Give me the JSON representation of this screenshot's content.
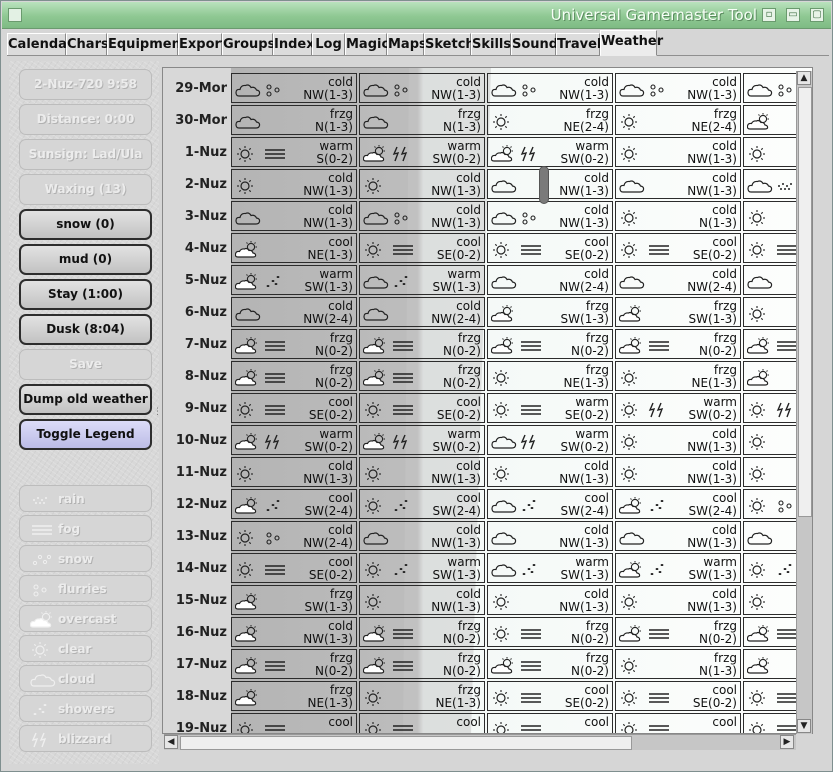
{
  "app": {
    "title": "Universal Gamemaster Tool",
    "controls": {
      "minimize": "▫",
      "maximize": "▭",
      "close": "▢"
    }
  },
  "tabs": [
    "Calendar",
    "Chars",
    "Equipment",
    "Export",
    "Groups",
    "Index",
    "Log",
    "Magic",
    "Maps",
    "Sketch",
    "Skills",
    "Sound",
    "Travel",
    "Weather"
  ],
  "active_tab": "Weather",
  "left_buttons": [
    {
      "label": "2-Nuz-720 9:58",
      "enabled": false
    },
    {
      "label": "Distance: 0:00",
      "enabled": false
    },
    {
      "label": "Sunsign: Lad/Ula",
      "enabled": false
    },
    {
      "label": "Waxing (13)",
      "enabled": false
    },
    {
      "label": "snow (0)",
      "enabled": true
    },
    {
      "label": "mud (0)",
      "enabled": true
    },
    {
      "label": "Stay (1:00)",
      "enabled": true
    },
    {
      "label": "Dusk (8:04)",
      "enabled": true
    },
    {
      "label": "Save",
      "enabled": false
    },
    {
      "label": "Dump old weather",
      "enabled": true
    },
    {
      "label": "Toggle Legend",
      "enabled": true,
      "style": "legend"
    }
  ],
  "legend": [
    {
      "label": "rain",
      "icon": "rain"
    },
    {
      "label": "fog",
      "icon": "fog"
    },
    {
      "label": "snow",
      "icon": "snow"
    },
    {
      "label": "flurries",
      "icon": "flurries"
    },
    {
      "label": "overcast",
      "icon": "overcast"
    },
    {
      "label": "clear",
      "icon": "clear"
    },
    {
      "label": "cloud",
      "icon": "cloud"
    },
    {
      "label": "showers",
      "icon": "showers"
    },
    {
      "label": "blizzard",
      "icon": "blizzard"
    }
  ],
  "weather": {
    "rows": [
      {
        "date": "29-Mor",
        "cells": [
          {
            "temp": "cold",
            "wind": "NW(1-3)",
            "icons": [
              "cloud",
              "flurries"
            ]
          },
          {
            "temp": "cold",
            "wind": "NW(1-3)",
            "icons": [
              "cloud",
              "flurries"
            ]
          },
          {
            "temp": "cold",
            "wind": "NW(1-3)",
            "icons": [
              "cloud",
              "flurries"
            ]
          },
          {
            "temp": "cold",
            "wind": "NW(1-3)",
            "icons": [
              "cloud",
              "flurries"
            ]
          },
          {
            "temp": "",
            "wind": "",
            "icons": [
              "cloud",
              "flurries"
            ]
          }
        ]
      },
      {
        "date": "30-Mor",
        "cells": [
          {
            "temp": "frzg",
            "wind": "N(1-3)",
            "icons": [
              "cloud"
            ]
          },
          {
            "temp": "frzg",
            "wind": "N(1-3)",
            "icons": [
              "cloud"
            ]
          },
          {
            "temp": "frzg",
            "wind": "NE(2-4)",
            "icons": [
              "clear"
            ]
          },
          {
            "temp": "frzg",
            "wind": "NE(2-4)",
            "icons": [
              "clear"
            ]
          },
          {
            "temp": "",
            "wind": "",
            "icons": [
              "overcast"
            ]
          }
        ]
      },
      {
        "date": "1-Nuz",
        "cells": [
          {
            "temp": "warm",
            "wind": "S(0-2)",
            "icons": [
              "clear",
              "fog"
            ]
          },
          {
            "temp": "warm",
            "wind": "SW(0-2)",
            "icons": [
              "overcast",
              "blizzard"
            ]
          },
          {
            "temp": "warm",
            "wind": "SW(0-2)",
            "icons": [
              "overcast",
              "blizzard"
            ]
          },
          {
            "temp": "cold",
            "wind": "NW(1-3)",
            "icons": [
              "clear"
            ]
          },
          {
            "temp": "",
            "wind": "",
            "icons": [
              "clear"
            ]
          }
        ]
      },
      {
        "date": "2-Nuz",
        "cells": [
          {
            "temp": "cold",
            "wind": "NW(1-3)",
            "icons": [
              "clear"
            ]
          },
          {
            "temp": "cold",
            "wind": "NW(1-3)",
            "icons": [
              "clear"
            ]
          },
          {
            "temp": "cold",
            "wind": "NW(1-3)",
            "icons": [
              "cloud"
            ]
          },
          {
            "temp": "cold",
            "wind": "NW(1-3)",
            "icons": [
              "cloud"
            ]
          },
          {
            "temp": "",
            "wind": "",
            "icons": [
              "cloud",
              "rain"
            ]
          }
        ]
      },
      {
        "date": "3-Nuz",
        "cells": [
          {
            "temp": "cold",
            "wind": "NW(1-3)",
            "icons": [
              "cloud"
            ]
          },
          {
            "temp": "cold",
            "wind": "NW(1-3)",
            "icons": [
              "cloud",
              "flurries"
            ]
          },
          {
            "temp": "cold",
            "wind": "NW(1-3)",
            "icons": [
              "cloud",
              "flurries"
            ]
          },
          {
            "temp": "cold",
            "wind": "N(1-3)",
            "icons": [
              "clear"
            ]
          },
          {
            "temp": "",
            "wind": "",
            "icons": [
              "clear"
            ]
          }
        ]
      },
      {
        "date": "4-Nuz",
        "cells": [
          {
            "temp": "cool",
            "wind": "NE(1-3)",
            "icons": [
              "overcast"
            ]
          },
          {
            "temp": "cool",
            "wind": "SE(0-2)",
            "icons": [
              "clear",
              "fog"
            ]
          },
          {
            "temp": "cool",
            "wind": "SE(0-2)",
            "icons": [
              "clear",
              "fog"
            ]
          },
          {
            "temp": "cool",
            "wind": "SE(0-2)",
            "icons": [
              "clear",
              "fog"
            ]
          },
          {
            "temp": "",
            "wind": "",
            "icons": [
              "clear",
              "fog"
            ]
          }
        ]
      },
      {
        "date": "5-Nuz",
        "cells": [
          {
            "temp": "warm",
            "wind": "SW(1-3)",
            "icons": [
              "overcast",
              "showers"
            ]
          },
          {
            "temp": "warm",
            "wind": "SW(1-3)",
            "icons": [
              "cloud",
              "showers"
            ]
          },
          {
            "temp": "cold",
            "wind": "NW(2-4)",
            "icons": [
              "cloud"
            ]
          },
          {
            "temp": "cold",
            "wind": "NW(2-4)",
            "icons": [
              "cloud"
            ]
          },
          {
            "temp": "",
            "wind": "",
            "icons": [
              "cloud"
            ]
          }
        ]
      },
      {
        "date": "6-Nuz",
        "cells": [
          {
            "temp": "cold",
            "wind": "NW(2-4)",
            "icons": [
              "cloud"
            ]
          },
          {
            "temp": "cold",
            "wind": "NW(2-4)",
            "icons": [
              "cloud"
            ]
          },
          {
            "temp": "frzg",
            "wind": "SW(1-3)",
            "icons": [
              "overcast"
            ]
          },
          {
            "temp": "frzg",
            "wind": "SW(1-3)",
            "icons": [
              "overcast"
            ]
          },
          {
            "temp": "",
            "wind": "",
            "icons": [
              "clear"
            ]
          }
        ]
      },
      {
        "date": "7-Nuz",
        "cells": [
          {
            "temp": "frzg",
            "wind": "N(0-2)",
            "icons": [
              "overcast",
              "fog"
            ]
          },
          {
            "temp": "frzg",
            "wind": "N(0-2)",
            "icons": [
              "overcast",
              "fog"
            ]
          },
          {
            "temp": "frzg",
            "wind": "N(0-2)",
            "icons": [
              "overcast",
              "fog"
            ]
          },
          {
            "temp": "frzg",
            "wind": "N(0-2)",
            "icons": [
              "overcast",
              "fog"
            ]
          },
          {
            "temp": "",
            "wind": "",
            "icons": [
              "overcast",
              "fog"
            ]
          }
        ]
      },
      {
        "date": "8-Nuz",
        "cells": [
          {
            "temp": "frzg",
            "wind": "N(0-2)",
            "icons": [
              "overcast",
              "fog"
            ]
          },
          {
            "temp": "frzg",
            "wind": "N(0-2)",
            "icons": [
              "overcast",
              "fog"
            ]
          },
          {
            "temp": "frzg",
            "wind": "NE(1-3)",
            "icons": [
              "clear"
            ]
          },
          {
            "temp": "frzg",
            "wind": "NE(1-3)",
            "icons": [
              "clear"
            ]
          },
          {
            "temp": "",
            "wind": "",
            "icons": [
              "overcast"
            ]
          }
        ]
      },
      {
        "date": "9-Nuz",
        "cells": [
          {
            "temp": "cool",
            "wind": "SE(0-2)",
            "icons": [
              "clear",
              "fog"
            ]
          },
          {
            "temp": "cool",
            "wind": "SE(0-2)",
            "icons": [
              "clear",
              "fog"
            ]
          },
          {
            "temp": "warm",
            "wind": "SE(0-2)",
            "icons": [
              "clear",
              "fog"
            ]
          },
          {
            "temp": "warm",
            "wind": "SW(0-2)",
            "icons": [
              "clear",
              "blizzard"
            ]
          },
          {
            "temp": "",
            "wind": "",
            "icons": [
              "clear",
              "blizzard"
            ]
          }
        ]
      },
      {
        "date": "10-Nuz",
        "cells": [
          {
            "temp": "warm",
            "wind": "SW(0-2)",
            "icons": [
              "overcast",
              "blizzard"
            ]
          },
          {
            "temp": "warm",
            "wind": "SW(0-2)",
            "icons": [
              "overcast",
              "blizzard"
            ]
          },
          {
            "temp": "warm",
            "wind": "SW(0-2)",
            "icons": [
              "cloud",
              "blizzard"
            ]
          },
          {
            "temp": "cold",
            "wind": "NW(1-3)",
            "icons": [
              "clear"
            ]
          },
          {
            "temp": "",
            "wind": "",
            "icons": [
              "clear"
            ]
          }
        ]
      },
      {
        "date": "11-Nuz",
        "cells": [
          {
            "temp": "cold",
            "wind": "NW(1-3)",
            "icons": [
              "clear"
            ]
          },
          {
            "temp": "cold",
            "wind": "NW(1-3)",
            "icons": [
              "clear"
            ]
          },
          {
            "temp": "cold",
            "wind": "NW(1-3)",
            "icons": [
              "clear"
            ]
          },
          {
            "temp": "cold",
            "wind": "NW(1-3)",
            "icons": [
              "clear"
            ]
          },
          {
            "temp": "",
            "wind": "",
            "icons": [
              "clear"
            ]
          }
        ]
      },
      {
        "date": "12-Nuz",
        "cells": [
          {
            "temp": "cool",
            "wind": "SW(2-4)",
            "icons": [
              "overcast",
              "showers"
            ]
          },
          {
            "temp": "cool",
            "wind": "SW(2-4)",
            "icons": [
              "clear",
              "showers"
            ]
          },
          {
            "temp": "cool",
            "wind": "SW(2-4)",
            "icons": [
              "cloud",
              "showers"
            ]
          },
          {
            "temp": "cool",
            "wind": "SW(2-4)",
            "icons": [
              "overcast",
              "showers"
            ]
          },
          {
            "temp": "",
            "wind": "",
            "icons": [
              "clear",
              "flurries"
            ]
          }
        ]
      },
      {
        "date": "13-Nuz",
        "cells": [
          {
            "temp": "cold",
            "wind": "NW(2-4)",
            "icons": [
              "clear",
              "flurries"
            ]
          },
          {
            "temp": "cold",
            "wind": "NW(1-3)",
            "icons": [
              "cloud"
            ]
          },
          {
            "temp": "cold",
            "wind": "NW(1-3)",
            "icons": [
              "cloud"
            ]
          },
          {
            "temp": "cold",
            "wind": "NW(1-3)",
            "icons": [
              "cloud"
            ]
          },
          {
            "temp": "",
            "wind": "",
            "icons": [
              "cloud"
            ]
          }
        ]
      },
      {
        "date": "14-Nuz",
        "cells": [
          {
            "temp": "cool",
            "wind": "SE(0-2)",
            "icons": [
              "clear",
              "fog"
            ]
          },
          {
            "temp": "warm",
            "wind": "SW(1-3)",
            "icons": [
              "clear",
              "showers"
            ]
          },
          {
            "temp": "warm",
            "wind": "SW(1-3)",
            "icons": [
              "cloud",
              "showers"
            ]
          },
          {
            "temp": "warm",
            "wind": "SW(1-3)",
            "icons": [
              "overcast",
              "showers"
            ]
          },
          {
            "temp": "",
            "wind": "",
            "icons": [
              "clear",
              "showers"
            ]
          }
        ]
      },
      {
        "date": "15-Nuz",
        "cells": [
          {
            "temp": "frzg",
            "wind": "SW(1-3)",
            "icons": [
              "overcast"
            ]
          },
          {
            "temp": "cold",
            "wind": "NW(1-3)",
            "icons": [
              "clear"
            ]
          },
          {
            "temp": "cold",
            "wind": "NW(1-3)",
            "icons": [
              "clear"
            ]
          },
          {
            "temp": "cold",
            "wind": "NW(1-3)",
            "icons": [
              "clear"
            ]
          },
          {
            "temp": "",
            "wind": "",
            "icons": [
              "clear"
            ]
          }
        ]
      },
      {
        "date": "16-Nuz",
        "cells": [
          {
            "temp": "cold",
            "wind": "NW(1-3)",
            "icons": [
              "overcast"
            ]
          },
          {
            "temp": "frzg",
            "wind": "N(0-2)",
            "icons": [
              "overcast",
              "fog"
            ]
          },
          {
            "temp": "frzg",
            "wind": "N(0-2)",
            "icons": [
              "clear",
              "fog"
            ]
          },
          {
            "temp": "frzg",
            "wind": "N(0-2)",
            "icons": [
              "overcast",
              "fog"
            ]
          },
          {
            "temp": "",
            "wind": "",
            "icons": [
              "overcast",
              "fog"
            ]
          }
        ]
      },
      {
        "date": "17-Nuz",
        "cells": [
          {
            "temp": "frzg",
            "wind": "N(0-2)",
            "icons": [
              "overcast",
              "fog"
            ]
          },
          {
            "temp": "frzg",
            "wind": "N(0-2)",
            "icons": [
              "overcast",
              "fog"
            ]
          },
          {
            "temp": "frzg",
            "wind": "N(0-2)",
            "icons": [
              "overcast",
              "fog"
            ]
          },
          {
            "temp": "frzg",
            "wind": "N(1-3)",
            "icons": [
              "clear"
            ]
          },
          {
            "temp": "",
            "wind": "",
            "icons": [
              "overcast"
            ]
          }
        ]
      },
      {
        "date": "18-Nuz",
        "cells": [
          {
            "temp": "frzg",
            "wind": "NE(1-3)",
            "icons": [
              "overcast"
            ]
          },
          {
            "temp": "frzg",
            "wind": "NE(1-3)",
            "icons": [
              "clear"
            ]
          },
          {
            "temp": "cool",
            "wind": "SE(0-2)",
            "icons": [
              "clear",
              "fog"
            ]
          },
          {
            "temp": "cool",
            "wind": "SE(0-2)",
            "icons": [
              "clear",
              "fog"
            ]
          },
          {
            "temp": "",
            "wind": "",
            "icons": [
              "clear",
              "fog"
            ]
          }
        ]
      },
      {
        "date": "19-Nuz",
        "cells": [
          {
            "temp": "cool",
            "wind": "",
            "icons": [
              "clear",
              "fog"
            ]
          },
          {
            "temp": "cool",
            "wind": "",
            "icons": [
              "clear",
              "fog"
            ]
          },
          {
            "temp": "cool",
            "wind": "",
            "icons": [
              "clear",
              "fog"
            ]
          },
          {
            "temp": "cool",
            "wind": "",
            "icons": [
              "clear",
              "fog"
            ]
          },
          {
            "temp": "",
            "wind": "",
            "icons": [
              "clear",
              "fog"
            ]
          }
        ]
      }
    ]
  },
  "colors": {
    "title_bar": "#8fc893",
    "legend_button": "#c8c8f0",
    "cell_light": "#fafdfc",
    "cell_dark": "#b4b4b4"
  }
}
